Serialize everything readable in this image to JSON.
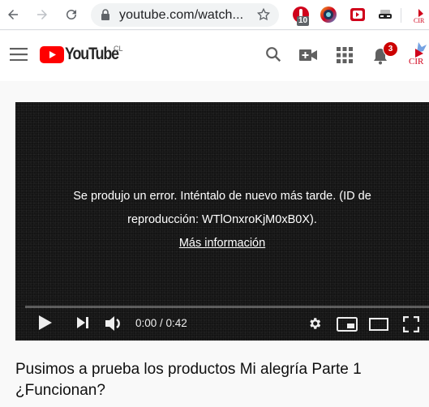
{
  "browser": {
    "url": "youtube.com/watch...",
    "extensions": [
      {
        "name": "ext-red-hand",
        "badge": "10"
      },
      {
        "name": "ext-color-circle"
      },
      {
        "name": "ext-red-tv"
      },
      {
        "name": "ext-incognito-mask"
      }
    ],
    "icons": {
      "back": "arrow-left-icon",
      "forward": "arrow-right-icon",
      "reload": "reload-icon",
      "lock": "lock-icon",
      "star": "star-icon"
    }
  },
  "header": {
    "logo_text": "YouTube",
    "country_code": "CL",
    "notification_count": "3",
    "avatar_text": "CIR",
    "colors": {
      "brand_red": "#ff0000",
      "badge_red": "#cc0000"
    }
  },
  "player": {
    "error_line1": "Se produjo un error. Inténtalo de nuevo más tarde. (ID de",
    "error_line2": "reproducción: WTlOnxroKjM0xB0X).",
    "more_info": "Más información",
    "time": "0:00 / 0:42",
    "progress": 0
  },
  "video": {
    "title": "Pusimos a prueba los productos Mi alegría Parte 1 ¿Funcionan?"
  }
}
